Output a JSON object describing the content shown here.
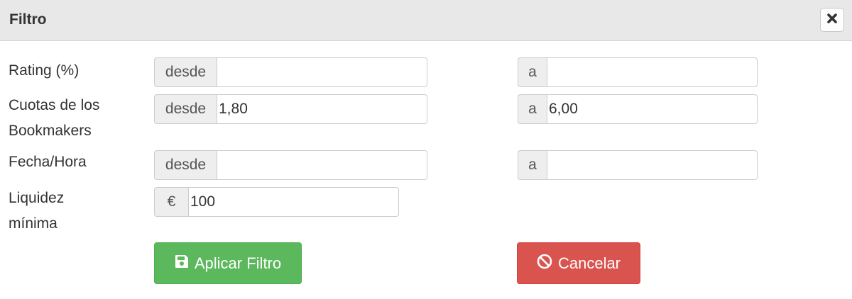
{
  "dialog": {
    "title": "Filtro"
  },
  "filters": {
    "rating": {
      "label": "Rating (%)",
      "from_addon": "desde",
      "from_value": "",
      "to_addon": "a",
      "to_value": ""
    },
    "odds": {
      "label_line1": "Cuotas de los",
      "label_line2": "Bookmakers",
      "from_addon": "desde",
      "from_value": "1,80",
      "to_addon": "a",
      "to_value": "6,00"
    },
    "datetime": {
      "label": "Fecha/Hora",
      "from_addon": "desde",
      "from_value": "",
      "to_addon": "a",
      "to_value": ""
    },
    "liquidity": {
      "label_line1": "Liquidez",
      "label_line2": "mínima",
      "currency_addon": "€",
      "value": "100"
    }
  },
  "actions": {
    "apply_label": "Aplicar Filtro",
    "cancel_label": "Cancelar"
  },
  "colors": {
    "apply": "#5cb85c",
    "cancel": "#d9534f",
    "header": "#e8e8e8"
  },
  "icons": {
    "close": "close-icon",
    "apply": "save-icon",
    "cancel": "ban-icon"
  }
}
